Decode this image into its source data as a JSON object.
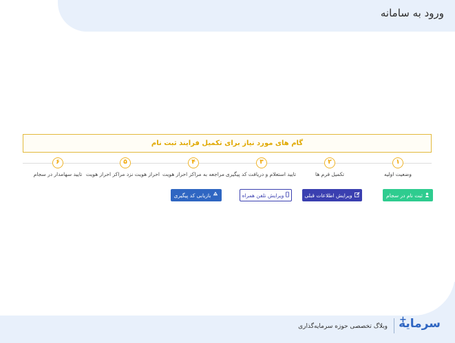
{
  "page_title": "ورود به سامانه",
  "notice_text": "گام های مورد نیاز برای تکمیل فرایند ثبت نام",
  "steps": [
    {
      "number": "۱",
      "label": "وضعیت اولیه"
    },
    {
      "number": "۲",
      "label": "تکمیل فرم ها"
    },
    {
      "number": "۳",
      "label": "تایید استعلام و دریافت کد پیگیری"
    },
    {
      "number": "۴",
      "label": "مراجعه به مراکز احراز هویت"
    },
    {
      "number": "۵",
      "label": "احراز هویت نزد مراکز احراز هویت"
    },
    {
      "number": "۶",
      "label": "تایید سهامدار در سجام"
    }
  ],
  "buttons": {
    "register": "ثبت نام در سجام",
    "edit_info": "ویرایش اطلاعات قبلی",
    "edit_phone": "ویرایش تلفن همراه",
    "recover_code": "بازیابی کد پیگیری"
  },
  "icons": {
    "register": "user-icon",
    "edit_info": "edit-icon",
    "edit_phone": "mobile-icon",
    "recover_code": "recycle-icon"
  },
  "footer": {
    "tagline": "وبلاگ تخصصی حوزه سرمایه‌گذاری",
    "logo_text": "سرمایه"
  },
  "colors": {
    "accent": "#f0b429",
    "primary": "#3a3fb0",
    "success": "#2ecc8f",
    "info": "#2f66c2",
    "band": "#e8f0fb"
  }
}
